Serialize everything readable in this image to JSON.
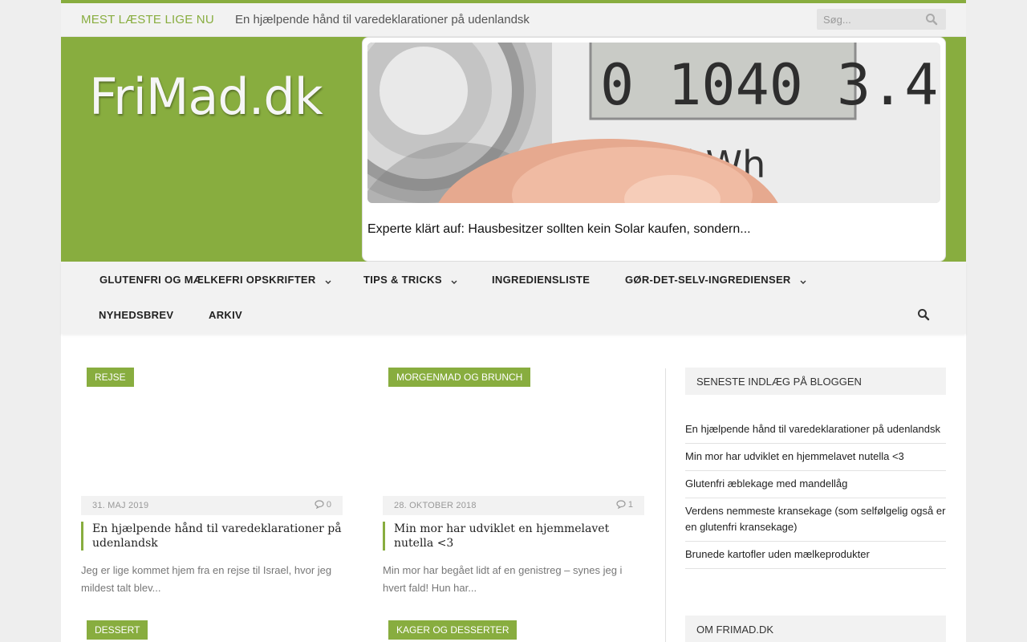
{
  "topbar": {
    "trending_label": "MEST LÆSTE LIGE NU",
    "trending_text": "En hjælpende hånd til varedeklarationer på udenlandsk",
    "search_placeholder": "Søg..."
  },
  "header": {
    "logo": "FriMad.dk",
    "ad": {
      "meter_reading": "0 1040 3.4",
      "meter_unit": "kWh",
      "caption": "Experte klärt auf: Hausbesitzer sollten kein Solar kaufen, sondern..."
    }
  },
  "nav": {
    "items": [
      {
        "label": "GLUTENFRI OG MÆLKEFRI OPSKRIFTER",
        "dropdown": true
      },
      {
        "label": "TIPS & TRICKS",
        "dropdown": true
      },
      {
        "label": "INGREDIENSLISTE",
        "dropdown": false
      },
      {
        "label": "GØR-DET-SELV-INGREDIENSER",
        "dropdown": true
      },
      {
        "label": "NYHEDSBREV",
        "dropdown": false
      },
      {
        "label": "ARKIV",
        "dropdown": false
      }
    ]
  },
  "posts": [
    {
      "category": "REJSE",
      "date": "31. MAJ 2019",
      "comments": "0",
      "title": "En hjælpende hånd til varedeklarationer på udenlandsk",
      "excerpt": "Jeg er lige kommet hjem fra en rejse til Israel, hvor jeg mildest talt blev..."
    },
    {
      "category": "MORGENMAD OG BRUNCH",
      "date": "28. OKTOBER 2018",
      "comments": "1",
      "title": "Min mor har udviklet en hjemmelavet nutella <3",
      "excerpt": "Min mor har begået lidt af en genistreg – synes jeg i hvert fald! Hun har..."
    },
    {
      "category": "DESSERT"
    },
    {
      "category": "KAGER OG DESSERTER"
    }
  ],
  "sidebar": {
    "recent_heading": "SENESTE INDLÆG PÅ BLOGGEN",
    "recent": [
      "En hjælpende hånd til varedeklarationer på udenlandsk",
      "Min mor har udviklet en hjemmelavet nutella <3",
      "Glutenfri æblekage med mandellåg",
      "Verdens nemmeste kransekage (som selfølgelig også er en glutenfri kransekage)",
      "Brunede kartofler uden mælkeprodukter"
    ],
    "about_heading": "OM FRIMAD.DK"
  },
  "colors": {
    "accent": "#88ad3f",
    "bar_bg": "#f2f2f2"
  }
}
